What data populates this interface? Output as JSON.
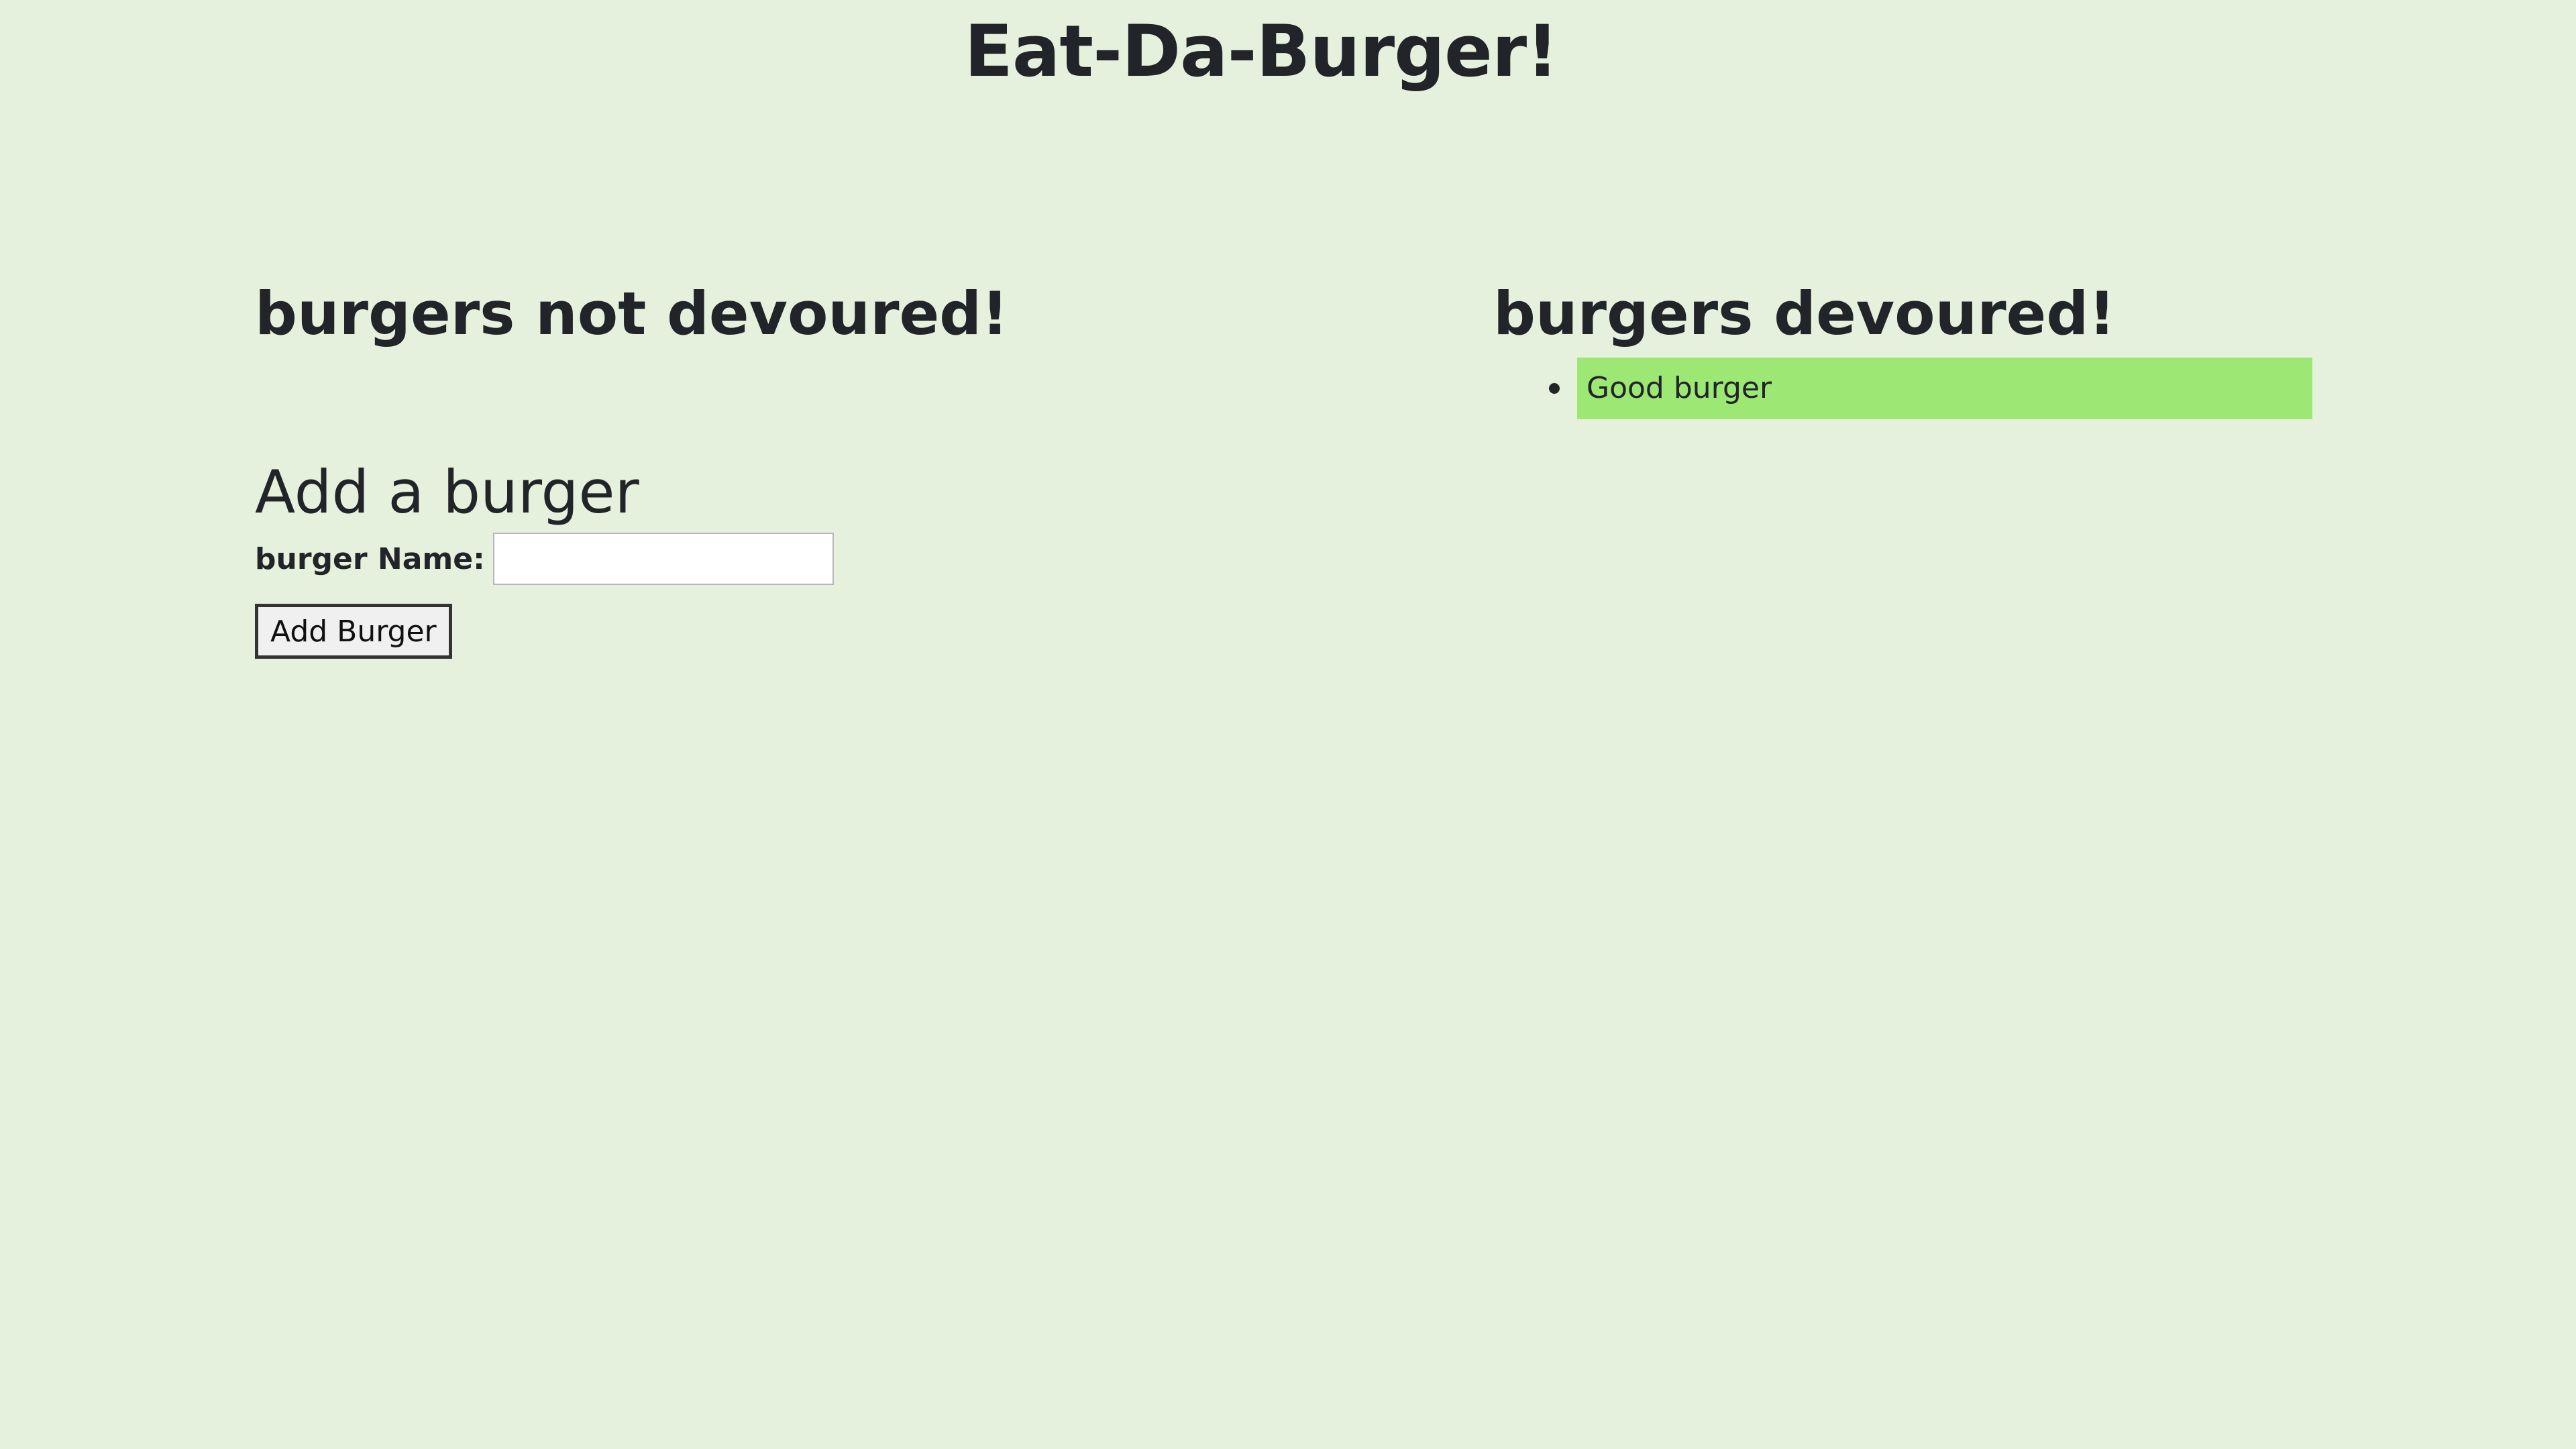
{
  "header": {
    "title": "Eat-Da-Burger!"
  },
  "not_devoured": {
    "heading": "burgers not devoured!",
    "items": []
  },
  "add_form": {
    "heading": "Add a burger",
    "name_label": "burger Name:",
    "name_value": "",
    "submit_label": "Add Burger"
  },
  "devoured": {
    "heading": "burgers devoured!",
    "items": [
      {
        "name": "Good burger"
      }
    ]
  },
  "colors": {
    "background": "#e5f1dc",
    "devoured_item_bg": "#9de774",
    "text": "#212529"
  }
}
